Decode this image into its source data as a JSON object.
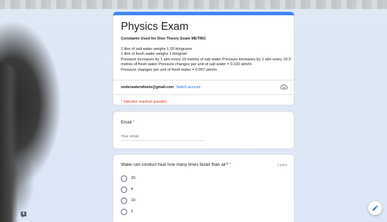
{
  "form": {
    "title": "Physics Exam",
    "subtitle": "Constants Used for Dive Theory Exam METRIC",
    "description": [
      "1 litre of salt water weighs 1.03 kilograms",
      "1 litre of fresh water weighs 1 kilogram",
      "Pressure increases by 1 atm every 10 metres of salt water Pressure increases by 1 atm every 10.3 metres of fresh water Pressure changes per unit of salt water = 0.100 atm/m",
      "Pressure changes per unit of fresh water = 0.097 atm/m"
    ],
    "account_email": "underwaterwheels@gmail.com",
    "switch_account_label": "Switch account",
    "required_notice": "* Indicates required question"
  },
  "email_question": {
    "label": "Email",
    "required_mark": "*",
    "placeholder": "Your email"
  },
  "question1": {
    "text": "Water can conduct heat how many times faster than air?",
    "required_mark": "*",
    "points": "1 point",
    "options": [
      "20",
      "4",
      "10",
      "2"
    ]
  },
  "icons": {
    "cloud": "cloud-saved-icon",
    "feedback": "feedback-icon",
    "edit": "pencil-icon"
  },
  "colors": {
    "accent": "#4285f4",
    "link": "#1a73e8",
    "required": "#d93025",
    "background": "#dbe6f7"
  }
}
